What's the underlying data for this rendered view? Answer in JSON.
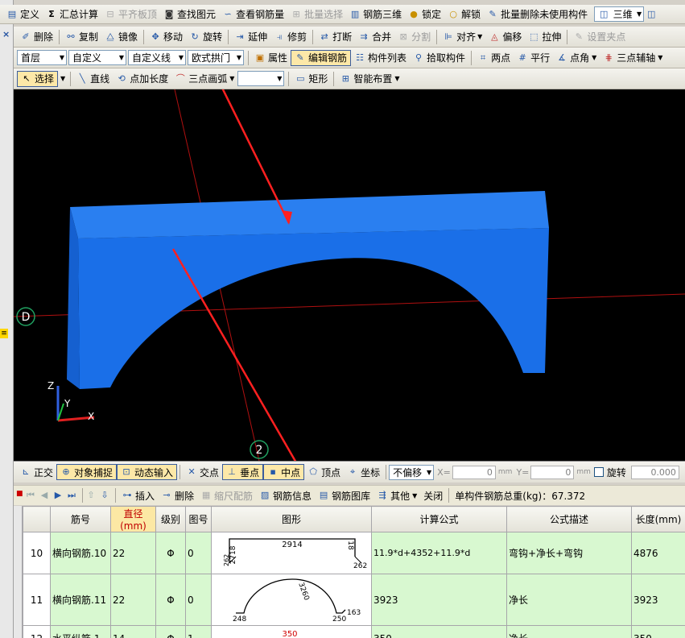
{
  "toolbar1": [
    {
      "icon": "define-icon",
      "label": "定义",
      "enabled": true
    },
    {
      "icon": "sum-icon",
      "glyph": "Σ",
      "label": "汇总计算",
      "enabled": true
    },
    {
      "icon": "align-slab-icon",
      "label": "平齐板顶",
      "enabled": false
    },
    {
      "icon": "binoculars-icon",
      "label": "查找图元",
      "enabled": true
    },
    {
      "icon": "view-rebar-icon",
      "label": "查看钢筋量",
      "enabled": true
    },
    {
      "icon": "batch-select-icon",
      "label": "批量选择",
      "enabled": false
    },
    {
      "icon": "rebar-3d-icon",
      "label": "钢筋三维",
      "enabled": true
    },
    {
      "icon": "lock-icon",
      "label": "锁定",
      "enabled": true
    },
    {
      "icon": "unlock-icon",
      "label": "解锁",
      "enabled": true
    },
    {
      "icon": "batch-delete-icon",
      "label": "批量删除未使用构件",
      "enabled": true
    }
  ],
  "view_mode": "三维",
  "toolbar2": [
    {
      "icon": "delete-icon",
      "label": "删除",
      "enabled": true
    },
    {
      "icon": "copy-icon",
      "label": "复制",
      "enabled": true
    },
    {
      "icon": "mirror-icon",
      "label": "镜像",
      "enabled": true
    },
    {
      "icon": "move-icon",
      "label": "移动",
      "enabled": true
    },
    {
      "icon": "rotate-icon",
      "label": "旋转",
      "enabled": true
    },
    {
      "icon": "extend-icon",
      "label": "延伸",
      "enabled": true
    },
    {
      "icon": "trim-icon",
      "label": "修剪",
      "enabled": true
    },
    {
      "icon": "break-icon",
      "label": "打断",
      "enabled": true
    },
    {
      "icon": "merge-icon",
      "label": "合并",
      "enabled": true
    },
    {
      "icon": "split-icon",
      "label": "分割",
      "enabled": false
    },
    {
      "icon": "align-icon",
      "label": "对齐",
      "enabled": true
    },
    {
      "icon": "offset-icon",
      "label": "偏移",
      "enabled": true
    },
    {
      "icon": "stretch-icon",
      "label": "拉伸",
      "enabled": true
    },
    {
      "icon": "set-pinch-icon",
      "label": "设置夹点",
      "enabled": false
    }
  ],
  "toolbar3": {
    "floor": "首层",
    "type": "自定义",
    "subtype": "自定义线",
    "element": "欧式拱门",
    "buttons": [
      {
        "icon": "property-icon",
        "label": "属性"
      },
      {
        "icon": "edit-rebar-icon",
        "label": "编辑钢筋",
        "active": true
      },
      {
        "icon": "component-list-icon",
        "label": "构件列表"
      },
      {
        "icon": "pick-component-icon",
        "label": "拾取构件"
      },
      {
        "icon": "two-point-icon",
        "label": "两点"
      },
      {
        "icon": "parallel-icon",
        "label": "平行"
      },
      {
        "icon": "point-angle-icon",
        "label": "点角"
      },
      {
        "icon": "three-point-aux-icon",
        "label": "三点辅轴"
      }
    ]
  },
  "toolbar4": {
    "select_label": "选择",
    "buttons": [
      {
        "icon": "line-icon",
        "label": "直线"
      },
      {
        "icon": "point-length-icon",
        "label": "点加长度"
      },
      {
        "icon": "three-point-arc-icon",
        "label": "三点画弧"
      }
    ],
    "rect_label": "矩形",
    "smart_label": "智能布置"
  },
  "viewport": {
    "axis_d": "D",
    "axis_2": "2",
    "axis_x": "X",
    "axis_y": "Y",
    "axis_z": "Z",
    "arch_color": "#1a6fe8"
  },
  "snapbar": {
    "ortho": "正交",
    "snap": "对象捕捉",
    "dyn_input": "动态输入",
    "intersect": "交点",
    "perp": "垂点",
    "mid": "中点",
    "vertex": "顶点",
    "coord": "坐标",
    "offset_mode": "不偏移",
    "x_label": "X=",
    "x_value": "0",
    "y_label": "Y=",
    "y_value": "0",
    "unit": "mm",
    "rotate": "旋转",
    "rotate_value": "0.000"
  },
  "rebarbar": {
    "insert": "插入",
    "delete": "删除",
    "scale_rebar": "缩尺配筋",
    "rebar_info": "钢筋信息",
    "rebar_library": "钢筋图库",
    "other": "其他",
    "close": "关闭",
    "total_weight": "单构件钢筋总重(kg)：67.372"
  },
  "table": {
    "headers": [
      "筋号",
      "直径(mm)",
      "级别",
      "图号",
      "图形",
      "计算公式",
      "公式描述",
      "长度(mm)"
    ],
    "rows": [
      {
        "num": "10",
        "name": "横向钢筋.10",
        "diameter": "22",
        "grade": "Φ",
        "fig_no": "0",
        "formula": "11.9*d+4352+11.9*d",
        "desc": "弯钩+净长+弯钩",
        "length": "4876",
        "shape_labels": {
          "left": "2718",
          "top": "2914",
          "right": "18",
          "hook_left": "262",
          "hook_right": "262"
        }
      },
      {
        "num": "11",
        "name": "横向钢筋.11",
        "diameter": "22",
        "grade": "Φ",
        "fig_no": "0",
        "formula": "3923",
        "desc": "净长",
        "length": "3923",
        "shape_labels": {
          "arc": "3260",
          "left": "248",
          "right": "250",
          "hook": "163"
        }
      },
      {
        "num": "12",
        "name": "水平纵筋.1",
        "diameter": "14",
        "grade": "Φ",
        "fig_no": "1",
        "formula": "350",
        "desc": "净长",
        "length": "350",
        "shape_labels": {
          "center": "350"
        }
      }
    ]
  }
}
